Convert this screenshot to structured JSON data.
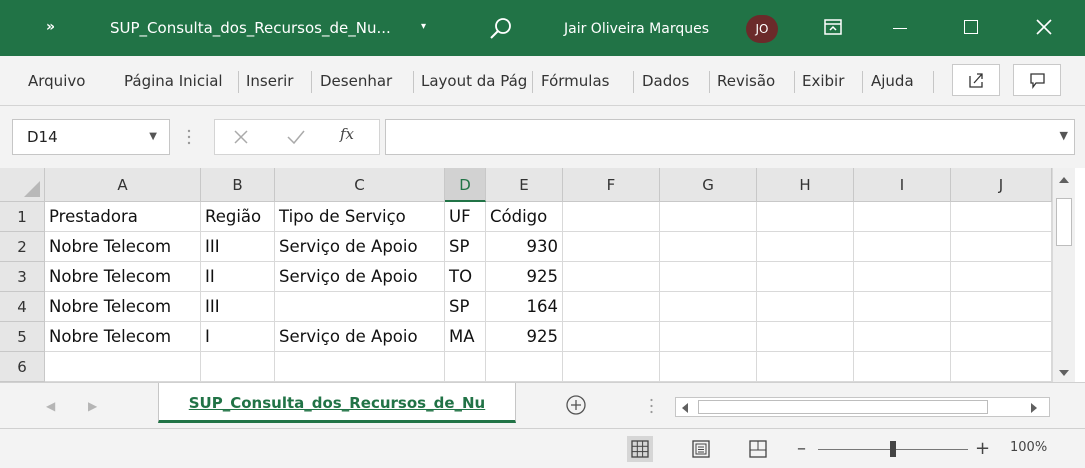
{
  "titlebar": {
    "chevron": "»",
    "title": "SUP_Consulta_dos_Recursos_de_Nu...",
    "title_caret": "▾",
    "user_name": "Jair Oliveira Marques",
    "user_initials": "JO",
    "accent_color": "#217346"
  },
  "menu": {
    "items": [
      "Arquivo",
      "Página Inicial",
      "Inserir",
      "Desenhar",
      "Layout da Página",
      "Fórmulas",
      "Dados",
      "Revisão",
      "Exibir",
      "Ajuda"
    ],
    "share_icon": "share-icon",
    "comments_icon": "comment-icon"
  },
  "formula_bar": {
    "name_box": "D14",
    "fx_label": "fx",
    "formula": ""
  },
  "grid": {
    "columns": [
      "A",
      "B",
      "C",
      "D",
      "E",
      "F",
      "G",
      "H",
      "I",
      "J"
    ],
    "selected_column": "D",
    "row_numbers": [
      "1",
      "2",
      "3",
      "4",
      "5",
      "6"
    ],
    "rows": [
      [
        "Prestadora",
        "Região",
        "Tipo de Serviço",
        "UF",
        "Código"
      ],
      [
        "Nobre Telecom",
        "III",
        "Serviço de Apoio",
        "SP",
        "930"
      ],
      [
        "Nobre Telecom",
        "II",
        "Serviço de Apoio",
        "TO",
        "925"
      ],
      [
        "Nobre Telecom",
        "III",
        "",
        "SP",
        "164"
      ],
      [
        "Nobre Telecom",
        "I",
        "Serviço de Apoio",
        "MA",
        "925"
      ],
      [
        "",
        "",
        "",
        "",
        ""
      ]
    ]
  },
  "sheets": {
    "active_tab": "SUP_Consulta_dos_Recursos_de_Nu",
    "nav_prev": "◀",
    "nav_next": "▶"
  },
  "status": {
    "zoom_minus": "–",
    "zoom_plus": "+",
    "zoom_level": "100%",
    "zoom_fraction": 0.5
  }
}
